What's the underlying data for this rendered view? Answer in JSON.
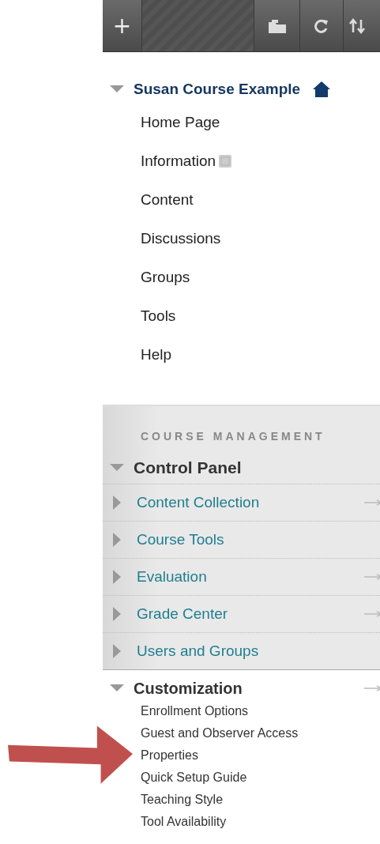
{
  "toolbar": {
    "buttons": [
      {
        "kind": "add",
        "label": "+"
      },
      {
        "kind": "spacer"
      },
      {
        "kind": "folder"
      },
      {
        "kind": "refresh"
      },
      {
        "kind": "sort"
      }
    ]
  },
  "course": {
    "title": "Susan Course Example",
    "expanded": true,
    "items": [
      {
        "label": "Home Page",
        "info": false
      },
      {
        "label": "Information",
        "info": true
      },
      {
        "label": "Content",
        "info": false
      },
      {
        "label": "Discussions",
        "info": false
      },
      {
        "label": "Groups",
        "info": false
      },
      {
        "label": "Tools",
        "info": false
      },
      {
        "label": "Help",
        "info": false
      }
    ]
  },
  "management": {
    "heading": "COURSE MANAGEMENT",
    "title": "Control Panel",
    "expanded": true,
    "items": [
      {
        "label": "Content Collection",
        "expanded": false,
        "quick_link": true
      },
      {
        "label": "Course Tools",
        "expanded": false,
        "quick_link": false
      },
      {
        "label": "Evaluation",
        "expanded": false,
        "quick_link": true
      },
      {
        "label": "Grade Center",
        "expanded": false,
        "quick_link": true
      },
      {
        "label": "Users and Groups",
        "expanded": false,
        "quick_link": false
      }
    ]
  },
  "customization": {
    "title": "Customization",
    "expanded": true,
    "quick_link": true,
    "items": [
      {
        "label": "Enrollment Options",
        "pointed": false
      },
      {
        "label": "Guest and Observer Access",
        "pointed": false
      },
      {
        "label": "Properties",
        "pointed": true
      },
      {
        "label": "Quick Setup Guide",
        "pointed": false
      },
      {
        "label": "Teaching Style",
        "pointed": false
      },
      {
        "label": "Tool Availability",
        "pointed": false
      }
    ]
  }
}
